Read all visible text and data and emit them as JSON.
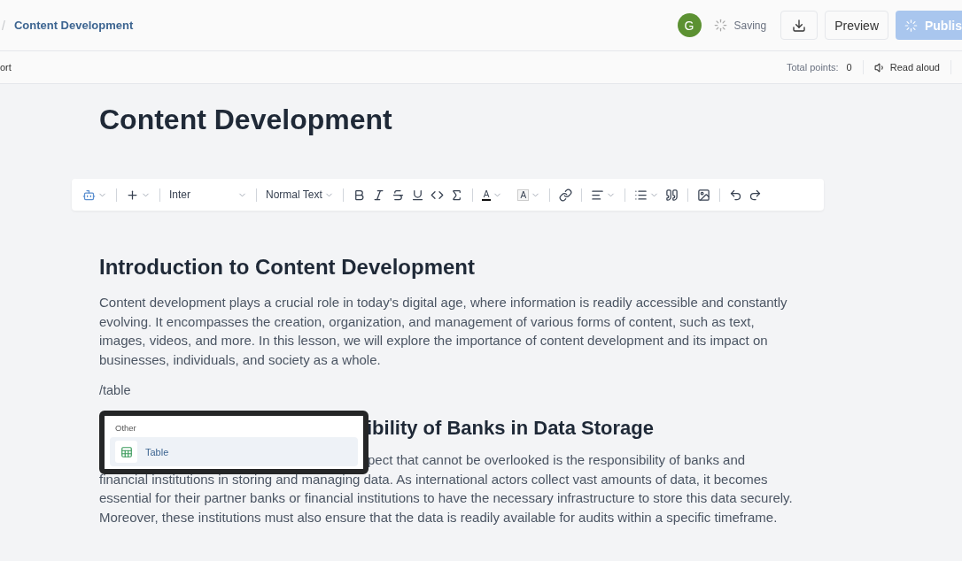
{
  "header": {
    "separator": "/",
    "breadcrumb": "Content Development",
    "avatar": "G",
    "status": "Saving",
    "preview": "Preview",
    "publish": "Publis"
  },
  "subbar": {
    "left": "ort",
    "points_label": "Total points:",
    "points_value": "0",
    "read_aloud": "Read aloud"
  },
  "title": "Content Development",
  "toolbar": {
    "font": "Inter",
    "style": "Normal Text",
    "text_color": "A",
    "highlight": "A"
  },
  "sections": [
    {
      "heading": "Introduction to Content Development",
      "lines": [
        "Content development plays a crucial role in today's digital age, where information is readily accessible and constantly evolving. It encompasses the creation, organization, and management of various forms of content, such as text, images, videos, and more. In this lesson, we will explore the importance of content development and its impact on businesses, individuals, and society as a whole."
      ]
    }
  ],
  "command": "/table",
  "popup": {
    "group": "Other",
    "items": [
      {
        "label": "Table",
        "selected": true
      }
    ]
  },
  "covered_section": {
    "heading": "ibility of Banks in Data Storage",
    "first_line": "pect that cannot be overlooked is the responsibility of banks and",
    "rest": "financial institutions in storing and managing data. As international actors collect vast amounts of data, it becomes essential for their partner banks or financial institutions to have the necessary infrastructure to store this data securely. Moreover, these institutions must also ensure that the data is readily available for audits within a specific timeframe."
  }
}
